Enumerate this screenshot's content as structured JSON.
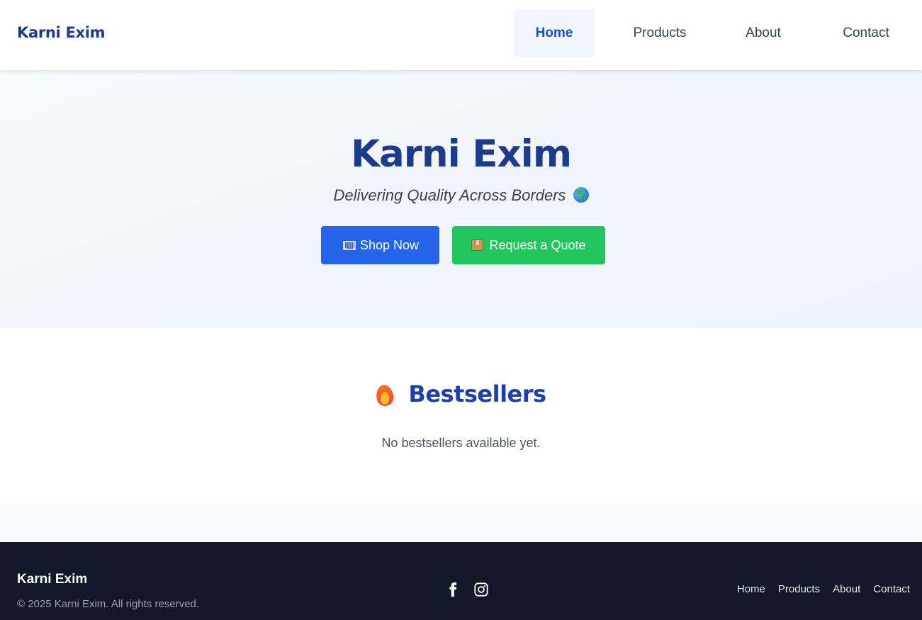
{
  "header": {
    "brand": "Karni Exim",
    "nav": [
      {
        "label": "Home",
        "active": true
      },
      {
        "label": "Products",
        "active": false
      },
      {
        "label": "About",
        "active": false
      },
      {
        "label": "Contact",
        "active": false
      }
    ]
  },
  "hero": {
    "title": "Karni Exim",
    "subtitle": "Delivering Quality Across Borders",
    "subtitle_icon": "globe-icon",
    "buttons": {
      "shop": {
        "label": "Shop Now",
        "icon": "cart-icon",
        "color": "#2563eb"
      },
      "quote": {
        "label": "Request a Quote",
        "icon": "package-icon",
        "color": "#22c55e"
      }
    }
  },
  "bestsellers": {
    "title": "Bestsellers",
    "title_icon": "flame-icon",
    "empty_message": "No bestsellers available yet."
  },
  "footer": {
    "brand": "Karni Exim",
    "copyright": "© 2025 Karni Exim. All rights reserved.",
    "social": [
      "facebook-icon",
      "instagram-icon"
    ],
    "links": [
      "Home",
      "Products",
      "About",
      "Contact"
    ]
  },
  "colors": {
    "brand_navy": "#1e3a8a",
    "primary_blue": "#2563eb",
    "success_green": "#22c55e",
    "footer_bg": "#111827"
  }
}
